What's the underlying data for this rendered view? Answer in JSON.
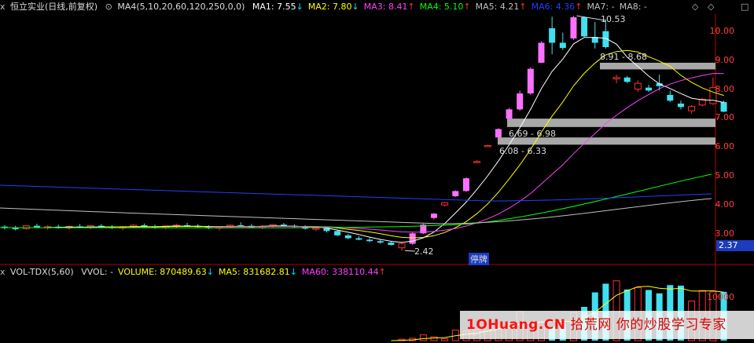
{
  "price_panel": {
    "close_icon": "x",
    "title": "恒立实业(日线,前复权)",
    "ma_group": "MA4(5,10,20,60,120,250,0,0)",
    "items": [
      {
        "label": "MA1: 7.55",
        "arrow": "↓",
        "color": "#ffffff"
      },
      {
        "label": "MA2: 7.80",
        "arrow": "↓",
        "color": "#ffff00"
      },
      {
        "label": "MA3: 8.41",
        "arrow": "↑",
        "color": "#ff40ff"
      },
      {
        "label": "MA4: 5.10",
        "arrow": "↑",
        "color": "#00ff00"
      },
      {
        "label": "MA5: 4.21",
        "arrow": "↑",
        "color": "#c0c0c0"
      },
      {
        "label": "MA6: 4.36",
        "arrow": "↑",
        "color": "#2040ff"
      },
      {
        "label": "MA7: -",
        "arrow": "",
        "color": "#c0c0c0"
      },
      {
        "label": "MA8: -",
        "arrow": "",
        "color": "#c0c0c0"
      }
    ],
    "y_ticks": [
      "10.00",
      "9.00",
      "8.00",
      "7.00",
      "6.00",
      "5.00",
      "4.00",
      "3.00"
    ],
    "price_tag": "2.37",
    "annotations": {
      "high": "10.53",
      "low": "2.42",
      "gap1": "8.91 - 8.68",
      "gap2": "6.69 - 6.98",
      "gap3": "6.08 - 6.33",
      "suspend": "停牌"
    }
  },
  "volume_panel": {
    "close_icon": "x",
    "title": "VOL-TDX(5,60)",
    "items": [
      {
        "label": "VVOL: -",
        "arrow": "",
        "color": "#dcdcdc"
      },
      {
        "label": "VOLUME: 870489.63",
        "arrow": "↓",
        "color": "#ffff00"
      },
      {
        "label": "MA5: 831682.81",
        "arrow": "↓",
        "color": "#ffff00"
      },
      {
        "label": "MA60: 338110.44",
        "arrow": "↑",
        "color": "#ff40ff"
      }
    ],
    "y_tick": "10000"
  },
  "window_controls": {
    "diamond": "◇",
    "diamond2": "◇",
    "square": "□"
  },
  "watermark": {
    "site": "1OHuang.CN",
    "text": " 拾荒网 你的炒股学习专家"
  },
  "colors": {
    "up": "#ff3030",
    "up_fill": "#ff70ff",
    "down": "#40e0f0",
    "axis": "#b00000"
  },
  "chart_data": [
    {
      "type": "candlestick",
      "ylim": [
        2.3,
        10.9
      ],
      "ohlc": [
        [
          3.25,
          3.3,
          3.15,
          3.2
        ],
        [
          3.2,
          3.28,
          3.12,
          3.18
        ],
        [
          3.18,
          3.3,
          3.15,
          3.28
        ],
        [
          3.28,
          3.35,
          3.2,
          3.22
        ],
        [
          3.22,
          3.3,
          3.15,
          3.25
        ],
        [
          3.25,
          3.32,
          3.18,
          3.2
        ],
        [
          3.2,
          3.28,
          3.14,
          3.26
        ],
        [
          3.26,
          3.34,
          3.2,
          3.22
        ],
        [
          3.22,
          3.3,
          3.16,
          3.28
        ],
        [
          3.28,
          3.34,
          3.2,
          3.24
        ],
        [
          3.24,
          3.3,
          3.17,
          3.2
        ],
        [
          3.2,
          3.27,
          3.13,
          3.25
        ],
        [
          3.25,
          3.33,
          3.2,
          3.3
        ],
        [
          3.3,
          3.36,
          3.22,
          3.26
        ],
        [
          3.26,
          3.32,
          3.18,
          3.22
        ],
        [
          3.22,
          3.28,
          3.15,
          3.27
        ],
        [
          3.27,
          3.35,
          3.21,
          3.3
        ],
        [
          3.3,
          3.38,
          3.24,
          3.28
        ],
        [
          3.28,
          3.34,
          3.2,
          3.24
        ],
        [
          3.24,
          3.3,
          3.16,
          3.2
        ],
        [
          3.2,
          3.26,
          3.12,
          3.24
        ],
        [
          3.24,
          3.32,
          3.2,
          3.3
        ],
        [
          3.3,
          3.4,
          3.25,
          3.28
        ],
        [
          3.28,
          3.34,
          3.2,
          3.22
        ],
        [
          3.22,
          3.3,
          3.16,
          3.26
        ],
        [
          3.26,
          3.34,
          3.22,
          3.32
        ],
        [
          3.32,
          3.38,
          3.25,
          3.28
        ],
        [
          3.28,
          3.33,
          3.2,
          3.24
        ],
        [
          3.24,
          3.3,
          3.15,
          3.18
        ],
        [
          3.18,
          3.24,
          3.1,
          3.2
        ],
        [
          3.2,
          3.24,
          3.05,
          3.1
        ],
        [
          3.1,
          3.15,
          2.92,
          2.95
        ],
        [
          2.95,
          3.0,
          2.82,
          2.85
        ],
        [
          2.85,
          2.92,
          2.78,
          2.8
        ],
        [
          2.8,
          2.86,
          2.72,
          2.75
        ],
        [
          2.75,
          2.8,
          2.66,
          2.7
        ],
        [
          2.7,
          2.75,
          2.6,
          2.62
        ],
        [
          2.52,
          2.72,
          2.42,
          2.66
        ],
        [
          2.66,
          3.05,
          2.62,
          3.02
        ],
        [
          3.02,
          3.35,
          3.0,
          3.32
        ],
        [
          3.55,
          3.72,
          3.5,
          3.7
        ],
        [
          4.0,
          4.1,
          3.95,
          4.08
        ],
        [
          4.3,
          4.5,
          4.28,
          4.48
        ],
        [
          4.48,
          4.95,
          4.45,
          4.92
        ],
        [
          5.5,
          5.55,
          5.45,
          5.5
        ],
        [
          6.05,
          6.08,
          6.0,
          6.05
        ],
        [
          6.33,
          6.65,
          6.3,
          6.62
        ],
        [
          6.98,
          7.35,
          6.95,
          7.3
        ],
        [
          7.3,
          7.95,
          7.25,
          7.85
        ],
        [
          7.85,
          8.75,
          7.8,
          8.7
        ],
        [
          8.91,
          9.65,
          8.9,
          9.6
        ],
        [
          10.1,
          10.5,
          9.2,
          9.6
        ],
        [
          9.6,
          9.95,
          9.35,
          9.42
        ],
        [
          9.75,
          10.53,
          9.7,
          10.48
        ],
        [
          10.48,
          10.5,
          9.8,
          9.82
        ],
        [
          9.8,
          10.32,
          9.4,
          9.6
        ],
        [
          10.0,
          10.4,
          9.4,
          9.45
        ],
        [
          8.35,
          8.5,
          8.2,
          8.4
        ],
        [
          8.4,
          8.45,
          8.2,
          8.25
        ],
        [
          8.0,
          8.3,
          7.9,
          8.2
        ],
        [
          8.05,
          8.15,
          7.9,
          7.95
        ],
        [
          8.2,
          8.5,
          7.95,
          8.1
        ],
        [
          7.8,
          7.95,
          7.55,
          7.6
        ],
        [
          7.5,
          7.6,
          7.3,
          7.38
        ],
        [
          7.25,
          7.45,
          7.15,
          7.4
        ],
        [
          7.45,
          7.7,
          7.4,
          7.65
        ],
        [
          7.5,
          8.4,
          7.45,
          8.05
        ],
        [
          7.55,
          7.6,
          7.2,
          7.22
        ]
      ]
    },
    {
      "type": "bar",
      "values": [
        0,
        0,
        0,
        0,
        0,
        0,
        0,
        0,
        0,
        0,
        0,
        0,
        0,
        0,
        0,
        0,
        0,
        0,
        0,
        0,
        0,
        0,
        0,
        0,
        0,
        0,
        0,
        0,
        0,
        0,
        0,
        0,
        0,
        0,
        0,
        0,
        0,
        300,
        500,
        1200,
        800,
        400,
        2200,
        2000,
        2300,
        3000,
        2500,
        3500,
        6000,
        3500,
        3800,
        3000,
        3600,
        5800,
        7000,
        10000,
        11800,
        12400,
        10600,
        11000,
        10500,
        9800,
        11500,
        11400,
        8200,
        10400,
        10100,
        10100
      ]
    }
  ]
}
